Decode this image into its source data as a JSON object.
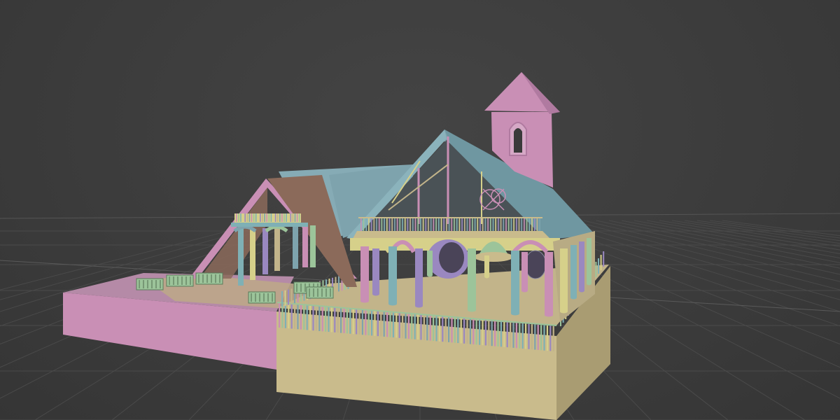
{
  "viewport": {
    "background": "#3d3d3d",
    "grid_color": "#4a4a4a",
    "horizon_color": "#525252"
  },
  "model": {
    "colors": {
      "pink": "#c98fb5",
      "pink_dark": "#b07aa0",
      "tan": "#c9bb8c",
      "tan_dark": "#a99c72",
      "roof_blue": "#7ea3ad",
      "roof_blue_dark": "#6a8f99",
      "brown": "#8b6a5a",
      "green": "#9cc49a",
      "teal": "#7fb0b5",
      "purple": "#9a88c0",
      "yellow": "#d6d08a",
      "sand": "#c2b48a"
    }
  }
}
